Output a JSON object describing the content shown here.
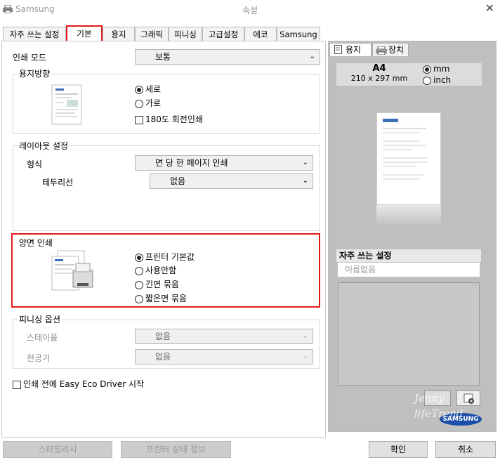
{
  "window": {
    "app": "Samsung",
    "title": "속성",
    "close": "✕"
  },
  "tabs": [
    "자주 쓰는 설정",
    "기본",
    "용지",
    "그래픽",
    "피니싱",
    "고급설정",
    "에코",
    "Samsung"
  ],
  "print_mode": {
    "label": "인쇄 모드",
    "value": "보통"
  },
  "orientation": {
    "title": "용지방향",
    "options": [
      "세로",
      "가로"
    ],
    "rotate": "180도 회전인쇄"
  },
  "layout": {
    "title": "레이아웃 설정",
    "type_label": "형식",
    "type_value": "면 당 한 페이지 인쇄",
    "border_label": "테두리선",
    "border_value": "없음"
  },
  "duplex": {
    "title": "양면 인쇄",
    "options": [
      "프린터 기본값",
      "사용안함",
      "긴면 묶음",
      "짧은면 묶음"
    ]
  },
  "finishing": {
    "title": "피니싱 옵션",
    "staple_label": "스테이플",
    "staple_value": "없음",
    "punch_label": "천공기",
    "punch_value": "없음"
  },
  "eco": {
    "label": "인쇄 전에 Easy Eco Driver 시작"
  },
  "right": {
    "tab_paper": "용지",
    "tab_device": "장치",
    "size": "A4",
    "dims": "210 x 297 mm",
    "unit_mm": "mm",
    "unit_inch": "inch",
    "fav_title": "자주 쓰는 설정",
    "fav_placeholder": "이름없음",
    "brand": "SAMSUNG",
    "watermark": "Jenny lifeTrend"
  },
  "buttons": {
    "style": "스타일리시",
    "status": "프린터 상태 정보",
    "ok": "확인",
    "cancel": "취소"
  }
}
